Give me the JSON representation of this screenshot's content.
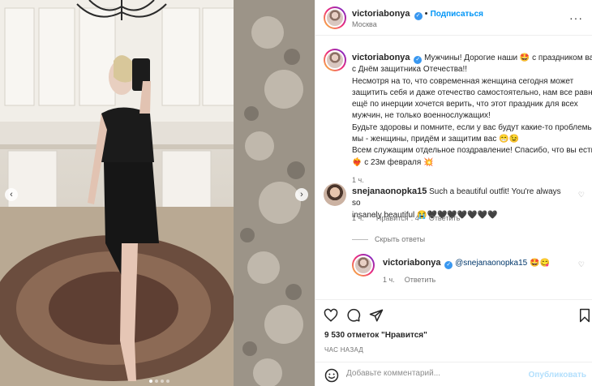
{
  "post": {
    "author": "victoriabonya",
    "follow_label": "Подписаться",
    "location": "Москва",
    "caption_lines": [
      "Мужчины! Дорогие наши 🤩 с праздником вас,",
      "с Днём защитника Отечества!!",
      "Несмотря на то, что современная женщина сегодня может",
      "защитить себя и даже отечество самостоятельно, нам все равно",
      "ещё по инерции хочется верить, что этот праздник для всех",
      "мужчин, не только военнослужащих!",
      "Будьте здоровы и помните, если у вас будут какие-то проблемы,",
      "мы - женщины, придём и защитим вас 😁😉",
      "Всем служащим отдельное поздравление! Спасибо, что вы есть!",
      "❤️‍🔥 с 23м февраля 💥"
    ],
    "caption_time": "1 ч."
  },
  "comments": [
    {
      "author": "snejanaonopka15",
      "text_line1": "Such a beautiful outfit! You're always so",
      "text_line2": "insanely beautiful 😭🖤🖤🖤🖤🖤🖤🖤",
      "time": "1 ч.",
      "likes": "\"Нравится\": 4",
      "reply": "Ответить",
      "hide_replies": "Скрыть ответы"
    }
  ],
  "reply": {
    "author": "victoriabonya",
    "mention": "@snejanaonopka15",
    "emoji": "🤩😋",
    "time": "1 ч.",
    "reply_label": "Ответить"
  },
  "stats": {
    "likes": "9 530 отметок \"Нравится\"",
    "time_ago": "ЧАС НАЗАД"
  },
  "composer": {
    "placeholder": "Добавьте комментарий...",
    "publish_label": "Опубликовать"
  },
  "icons": {
    "verified": "verified-badge-icon",
    "like": "heart-icon",
    "comment": "comment-icon",
    "share": "paper-plane-icon",
    "save": "bookmark-icon",
    "emoji": "smiley-icon",
    "more": "more-icon"
  },
  "carousel": {
    "total": 4,
    "active": 1
  },
  "colors": {
    "link": "#0095f6",
    "verified": "#3897f0",
    "publish_disabled": "#b2dffc",
    "meta": "#737373"
  }
}
